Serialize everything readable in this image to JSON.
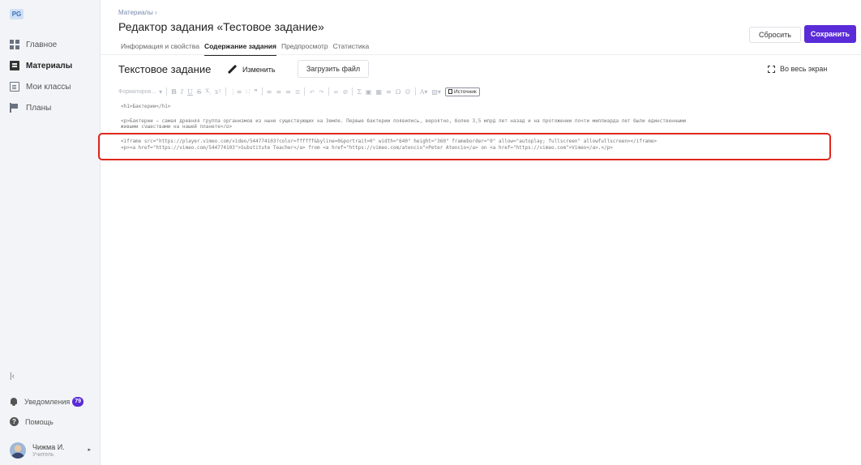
{
  "sidebar": {
    "logo": "PG",
    "items": [
      {
        "label": "Главное",
        "icon": "dashboard-icon"
      },
      {
        "label": "Материалы",
        "icon": "document-icon",
        "active": true
      },
      {
        "label": "Мои классы",
        "icon": "classes-icon"
      },
      {
        "label": "Планы",
        "icon": "flag-icon"
      }
    ],
    "collapse_label": "|‹",
    "notifications": {
      "label": "Уведомления",
      "count": "79"
    },
    "help_label": "Помощь",
    "user": {
      "name": "Чижма И.",
      "role": "Учитель"
    }
  },
  "header": {
    "breadcrumb": "Материалы ›",
    "title": "Редактор задания «Тестовое задание»",
    "tabs": [
      {
        "label": "Информация и свойства"
      },
      {
        "label": "Содержание задания",
        "active": true
      },
      {
        "label": "Предпросмотр"
      },
      {
        "label": "Статистика"
      }
    ],
    "reset_label": "Сбросить",
    "save_label": "Сохранить"
  },
  "editor": {
    "title": "Текстовое задание",
    "edit_label": "Изменить",
    "upload_label": "Загрузить файл",
    "fullscreen_label": "Во весь экран",
    "toolbar": {
      "format_label": "Форматиров...",
      "source_label": "Источник"
    },
    "code_lines": [
      "<h1>Бактерии</h1>",
      "<p>Бактерии — самая древняя группа организмов из ныне существующих на Земле. Первые бактерии появились, вероятно, более  3,5  млрд лет назад и на протяжении почти миллиарда лет были единственными",
      "живыми существами на нашей планете</p>",
      "<iframe src=\"https://player.vimeo.com/video/544774103?color=ffffff&byline=0&portrait=0\" width=\"640\" height=\"360\" frameborder=\"0\" allow=\"autoplay; fullscreen\" allowfullscreen></iframe>",
      "<p><a href=\"https://vimeo.com/544774103\">Substitute Teacher</a> from <a href=\"https://vimeo.com/atencio\">Peter Atencio</a> on <a href=\"https://vimeo.com\">Vimeo</a>.</p>"
    ]
  },
  "colors": {
    "accent": "#5a2bd8",
    "highlight_border": "#e0261b"
  }
}
